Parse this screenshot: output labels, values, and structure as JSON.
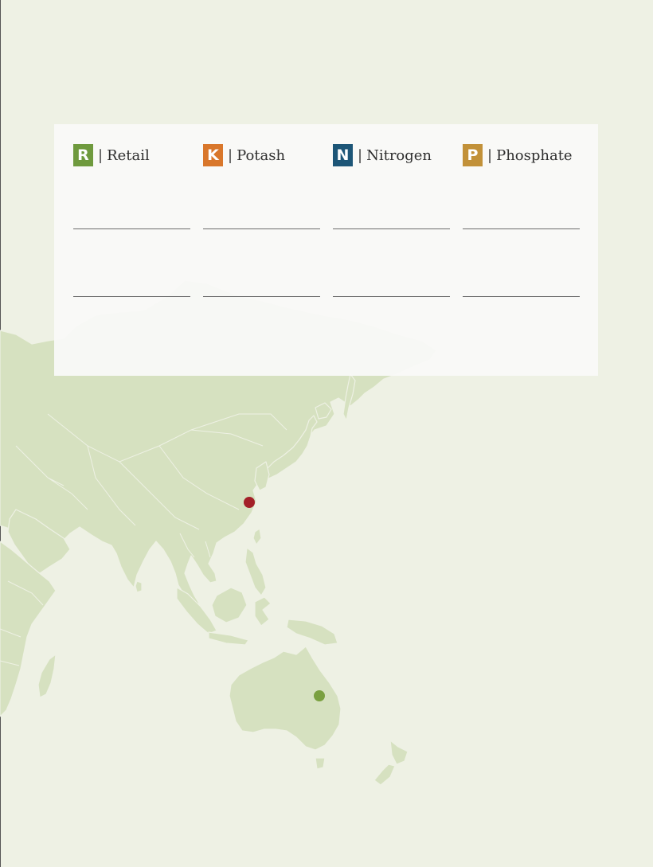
{
  "legend": {
    "items": [
      {
        "letter": "R",
        "label": "Retail",
        "color": "#6f9a3e"
      },
      {
        "letter": "K",
        "label": "Potash",
        "color": "#d9772b"
      },
      {
        "letter": "N",
        "label": "Nitrogen",
        "color": "#1d5677"
      },
      {
        "letter": "P",
        "label": "Phosphate",
        "color": "#c29139"
      }
    ],
    "separator": "|"
  },
  "map": {
    "land_color": "#d6e1c0",
    "background_color": "#eef1e4",
    "markers": [
      {
        "location": "China (Shanghai region)",
        "color": "#a32028"
      },
      {
        "location": "Australia (Queensland)",
        "color": "#7aa040"
      }
    ]
  }
}
